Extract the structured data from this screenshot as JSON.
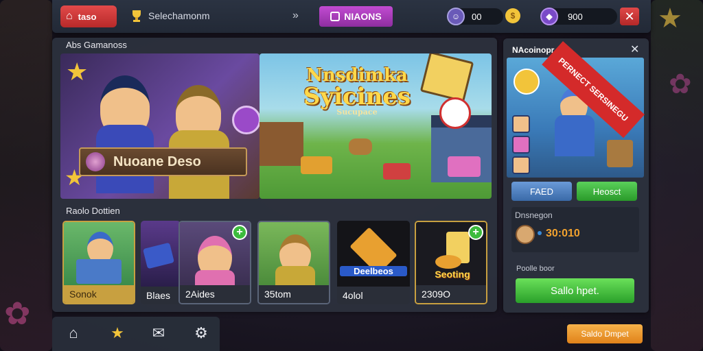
{
  "topbar": {
    "home_label": "taso",
    "title": "Selechamonm",
    "chevron": "»",
    "mid_label": "NIAONS",
    "currency1_value": "00",
    "currency2_value": "900",
    "close_glyph": "✕"
  },
  "main": {
    "banner_section_label": "Abs Gamanoss",
    "banner_left_button": "Nuoane Deso",
    "banner_right_title_line1": "Nnsdimka",
    "banner_right_title_line2": "Syicines",
    "banner_right_subtitle": "Sucupace",
    "cards_section_label": "Raolo Dottien",
    "cards": [
      {
        "label": "Sonok",
        "icon": "builder-robot-icon"
      },
      {
        "label": "Blaes",
        "icon": "machine-icon"
      },
      {
        "label": "2Aides",
        "icon": "pink-hat-kid-icon"
      },
      {
        "label": "35tom",
        "icon": "explorer-kid-icon"
      },
      {
        "label": "4olol",
        "icon": "treasure-box-icon",
        "art_text": "Deelbeos"
      },
      {
        "label": "2309O",
        "icon": "gold-coins-icon",
        "art_text": "Seoting"
      }
    ]
  },
  "side": {
    "header": "NAcoinopr",
    "close_glyph": "✕",
    "ribbon_text": "PERNECT SERSINEGU",
    "btn_blue": "FAED",
    "btn_green": "Heosct",
    "section_label": "Dnsnegon",
    "value": "30:010",
    "section2_label": "Poolle boor",
    "big_green_btn": "Sallo hpet.",
    "orange_btn": "Saldo Dmpet"
  },
  "colors": {
    "red": "#d83a3a",
    "purple": "#b03cc2",
    "green": "#3dbb3d",
    "orange": "#f2a22e",
    "gold": "#ffd84a"
  }
}
